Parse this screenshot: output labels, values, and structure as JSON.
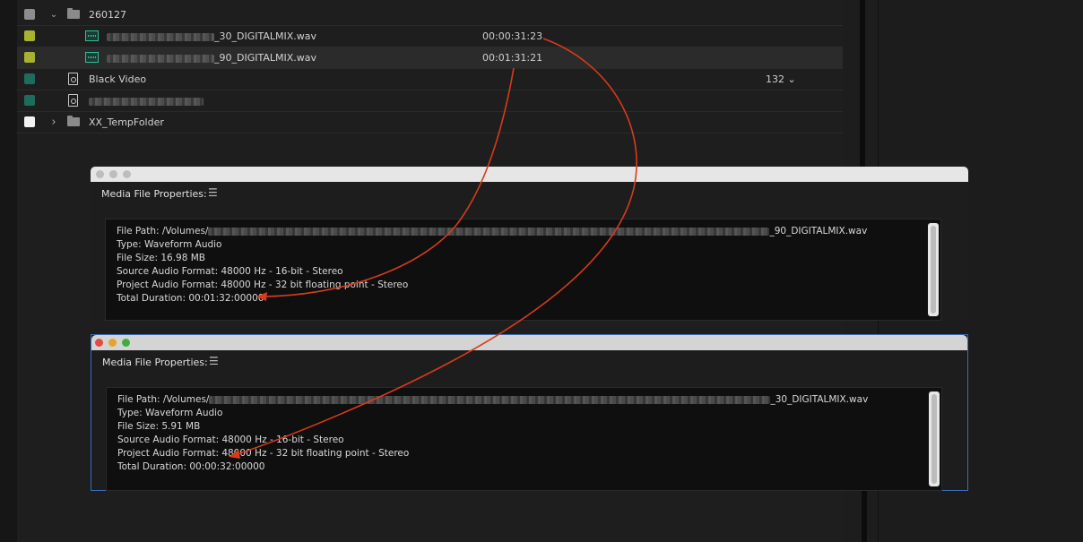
{
  "project": {
    "rows": [
      {
        "name": "260127",
        "swatch": "#8d8d8d",
        "type": "folder",
        "expanded": true
      },
      {
        "name": "_30_DIGITALMIX.wav",
        "swatch": "#a8b22f",
        "type": "audio",
        "duration": "00:00:31:23"
      },
      {
        "name": "_90_DIGITALMIX.wav",
        "swatch": "#a8b22f",
        "type": "audio",
        "duration": "00:01:31:21",
        "selected": true
      },
      {
        "name": "Black Video",
        "swatch": "#1f6b5e",
        "type": "file",
        "extra": "132"
      },
      {
        "name": "",
        "swatch": "#1f6b5e",
        "type": "file"
      },
      {
        "name": "XX_TempFolder",
        "swatch": "#f2f2f2",
        "type": "folder",
        "expanded": false
      }
    ],
    "extra_chevron": "⌄",
    "chevron_open": "⌄",
    "chevron_closed": "›"
  },
  "dialogs": [
    {
      "title": "Media File Properties:",
      "menu_icon": "☰",
      "file_path_prefix": "File Path: /Volumes/",
      "file_path_suffix": "_90_DIGITALMIX.wav",
      "type": "Type: Waveform Audio",
      "file_size": "File Size: 16.98 MB",
      "source_format": "Source Audio Format: 48000 Hz - 16-bit - Stereo",
      "project_format": "Project Audio Format: 48000 Hz - 32 bit floating point - Stereo",
      "total_duration": "Total Duration: 00:01:32:00000"
    },
    {
      "title": "Media File Properties:",
      "menu_icon": "☰",
      "file_path_prefix": "File Path: /Volumes/",
      "file_path_suffix": "_30_DIGITALMIX.wav",
      "type": "Type: Waveform Audio",
      "file_size": "File Size: 5.91 MB",
      "source_format": "Source Audio Format: 48000 Hz - 16-bit - Stereo",
      "project_format": "Project Audio Format: 48000 Hz - 32 bit floating point - Stereo",
      "total_duration": "Total Duration: 00:00:32:00000"
    }
  ],
  "colors": {
    "annotation_arrow": "#d93a1c",
    "active_border": "#3b6db8"
  }
}
